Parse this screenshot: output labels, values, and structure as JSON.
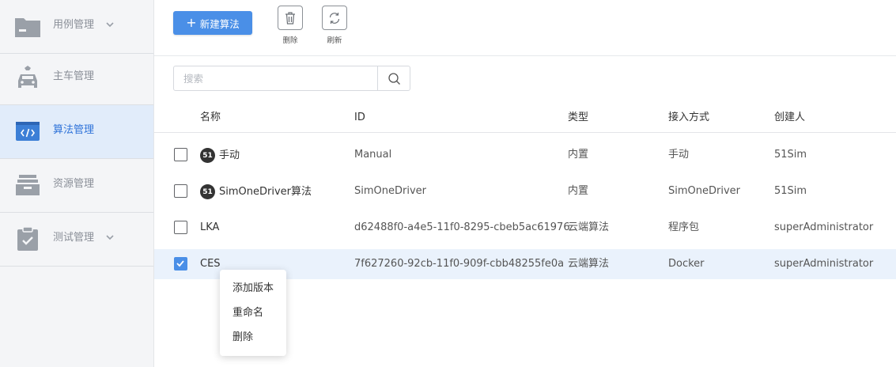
{
  "sidebar": {
    "items": [
      {
        "label": "用例管理",
        "icon": "folder-icon",
        "has_chevron": true,
        "active": false
      },
      {
        "label": "主车管理",
        "icon": "car-icon",
        "has_chevron": false,
        "active": false
      },
      {
        "label": "算法管理",
        "icon": "code-icon",
        "has_chevron": false,
        "active": true
      },
      {
        "label": "资源管理",
        "icon": "tray-icon",
        "has_chevron": false,
        "active": false
      },
      {
        "label": "测试管理",
        "icon": "clipboard-check-icon",
        "has_chevron": true,
        "active": false
      }
    ]
  },
  "toolbar": {
    "new_label": "新建算法",
    "delete_label": "删除",
    "refresh_label": "刷新"
  },
  "search": {
    "placeholder": "搜索",
    "value": ""
  },
  "table": {
    "columns": [
      "名称",
      "ID",
      "类型",
      "接入方式",
      "创建人"
    ],
    "rows": [
      {
        "name": "手动",
        "logo": "51",
        "id": "Manual",
        "type": "内置",
        "access": "手动",
        "creator": "51Sim",
        "checked": false
      },
      {
        "name": "SimOneDriver算法",
        "logo": "51",
        "id": "SimOneDriver",
        "type": "内置",
        "access": "SimOneDriver",
        "creator": "51Sim",
        "checked": false
      },
      {
        "name": "LKA",
        "logo": "",
        "id": "d62488f0-a4e5-11f0-8295-cbeb5ac61976",
        "type": "云端算法",
        "access": "程序包",
        "creator": "superAdministrator",
        "checked": false
      },
      {
        "name": "CES",
        "logo": "",
        "id": "7f627260-92cb-11f0-909f-cbb48255fe0a",
        "type": "云端算法",
        "access": "Docker",
        "creator": "superAdministrator",
        "checked": true
      }
    ]
  },
  "context_menu": {
    "items": [
      "添加版本",
      "重命名",
      "删除"
    ]
  },
  "colors": {
    "accent": "#4a8fe7",
    "active_nav_bg": "#e1ecfa",
    "selected_row_bg": "#eaf2fc"
  }
}
